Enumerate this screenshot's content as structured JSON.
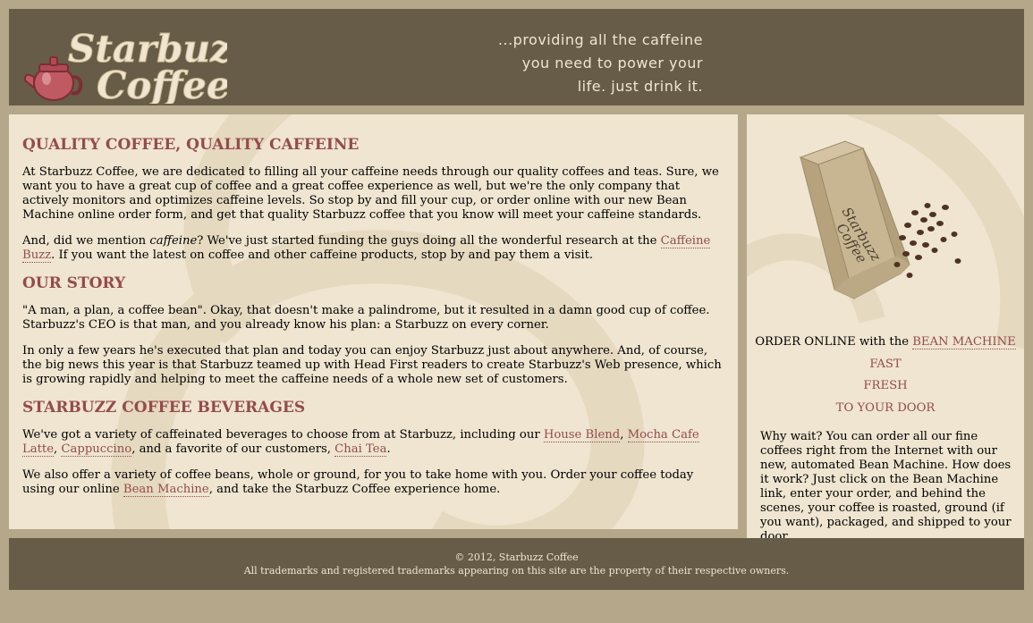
{
  "header": {
    "logo_line1": "Starbuzz",
    "logo_line2": "Coffee",
    "slogan_lines": [
      "...providing all the caffeine",
      "you need to power your",
      "life. just drink it."
    ]
  },
  "main": {
    "section1": {
      "heading": "QUALITY COFFEE, QUALITY CAFFEINE",
      "p1": "At Starbuzz Coffee, we are dedicated to filling all your caffeine needs through our quality coffees and teas. Sure, we want you to have a great cup of coffee and a great coffee experience as well, but we're the only company that actively monitors and optimizes caffeine levels. So stop by and fill your cup, or order online with our new Bean Machine online order form, and get that quality Starbuzz coffee that you know will meet your caffeine standards.",
      "p2_a": "And, did we mention ",
      "p2_em": "caffeine",
      "p2_b": "? We've just started funding the guys doing all the wonderful research at the ",
      "p2_link": "Caffeine Buzz",
      "p2_c": ". If you want the latest on coffee and other caffeine products, stop by and pay them a visit."
    },
    "section2": {
      "heading": "OUR STORY",
      "p1": "\"A man, a plan, a coffee bean\". Okay, that doesn't make a palindrome, but it resulted in a damn good cup of coffee. Starbuzz's CEO is that man, and you already know his plan: a Starbuzz on every corner.",
      "p2": "In only a few years he's executed that plan and today you can enjoy Starbuzz just about anywhere. And, of course, the big news this year is that Starbuzz teamed up with Head First readers to create Starbuzz's Web presence, which is growing rapidly and helping to meet the caffeine needs of a whole new set of customers."
    },
    "section3": {
      "heading": "STARBUZZ COFFEE BEVERAGES",
      "p1_a": "We've got a variety of caffeinated beverages to choose from at Starbuzz, including our ",
      "link_house": "House Blend",
      "sep1": ", ",
      "link_mocha": "Mocha Cafe Latte",
      "sep2": ", ",
      "link_cappuccino": "Cappuccino",
      "p1_b": ", and a favorite of our customers, ",
      "link_chai": "Chai Tea",
      "p1_c": ".",
      "p2_a": "We also offer a variety of coffee beans, whole or ground, for you to take home with you. Order your coffee today using our online ",
      "link_bean": "Bean Machine",
      "p2_b": ", and take the Starbuzz Coffee experience home."
    }
  },
  "sidebar": {
    "bag_text1": "Starbuzz",
    "bag_text2": "Coffee",
    "order_prefix": "ORDER ONLINE with the ",
    "order_link": "BEAN MACHINE",
    "line_fast": "FAST",
    "line_fresh": "FRESH",
    "line_door": "TO YOUR DOOR",
    "description": "Why wait? You can order all our fine coffees right from the Internet with our new, automated Bean Machine. How does it work? Just click on the Bean Machine link, enter your order, and behind the scenes, your coffee is roasted, ground (if you want), packaged, and shipped to your door."
  },
  "footer": {
    "copyright": "© 2012, Starbuzz Coffee",
    "trademarks": "All trademarks and registered trademarks appearing on this site are the property of their respective owners."
  },
  "colors": {
    "header_bg": "#675c47",
    "page_bg": "#b5a789",
    "content_bg": "#efe5d0",
    "accent": "#954b4b"
  }
}
